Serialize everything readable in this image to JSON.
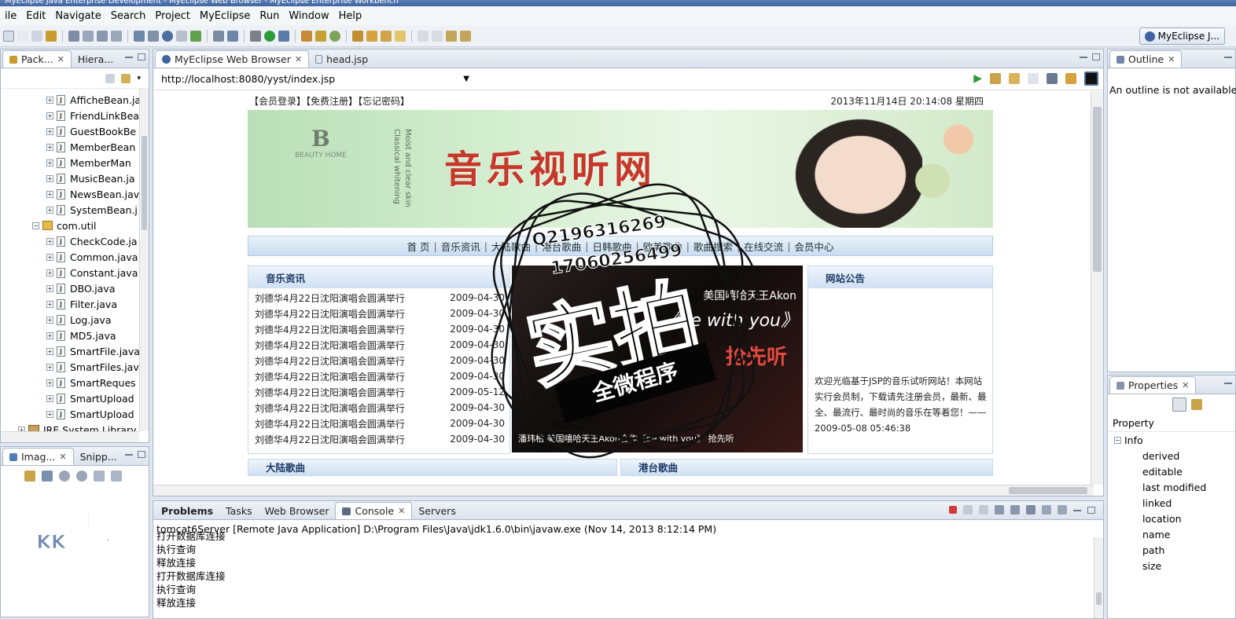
{
  "window": {
    "title": "MyEclipse Java Enterprise Development - MyEclipse Web Browser - MyEclipse Enterprise Workbench"
  },
  "menu": [
    "ile",
    "Edit",
    "Navigate",
    "Search",
    "Project",
    "MyEclipse",
    "Run",
    "Window",
    "Help"
  ],
  "perspective": {
    "label": "MyEclipse J..."
  },
  "explorer": {
    "tabs": [
      "Pack...",
      "Hiera..."
    ],
    "items": [
      "AfficheBean.ja",
      "FriendLinkBea",
      "GuestBookBe",
      "MemberBean",
      "MemberMan",
      "MusicBean.ja",
      "NewsBean.jav",
      "SystemBean.j"
    ],
    "package": "com.util",
    "util_items": [
      "CheckCode.ja",
      "Common.java",
      "Constant.java",
      "DBO.java",
      "Filter.java",
      "Log.java",
      "MD5.java",
      "SmartFile.java",
      "SmartFiles.jav",
      "SmartReques",
      "SmartUpload",
      "SmartUpload"
    ],
    "library": "JRE System Library"
  },
  "image_panel": {
    "tabs": [
      "Imag...",
      "Snipp..."
    ],
    "watermark": "录制工具 KK录像机"
  },
  "editor": {
    "tabs": [
      "MyEclipse Web Browser",
      "head.jsp"
    ],
    "url": "http://localhost:8080/yyst/index.jsp"
  },
  "site": {
    "links": "【会员登录】【免费注册】【忘记密码】",
    "datetime": "2013年11月14日 20:14:08  星期四",
    "banner_title": "音乐视听网",
    "banner_logo": "BEAUTY HOME",
    "banner_tagline": "Moist and clear skin Classical whitening",
    "nav": [
      "首 页",
      "音乐资讯",
      "大陆歌曲",
      "港台歌曲",
      "日韩歌曲",
      "欧美歌曲",
      "歌曲搜索",
      "在线交流",
      "会员中心"
    ],
    "news_title": "音乐资讯",
    "news": [
      {
        "title": "刘德华4月22日沈阳演唱会圆满举行",
        "date": "2009-04-30"
      },
      {
        "title": "刘德华4月22日沈阳演唱会圆满举行",
        "date": "2009-04-30"
      },
      {
        "title": "刘德华4月22日沈阳演唱会圆满举行",
        "date": "2009-04-30"
      },
      {
        "title": "刘德华4月22日沈阳演唱会圆满举行",
        "date": "2009-04-30"
      },
      {
        "title": "刘德华4月22日沈阳演唱会圆满举行",
        "date": "2009-04-30"
      },
      {
        "title": "刘德华4月22日沈阳演唱会圆满举行",
        "date": "2009-04-30"
      },
      {
        "title": "刘德华4月22日沈阳演唱会圆满举行",
        "date": "2009-05-12"
      },
      {
        "title": "刘德华4月22日沈阳演唱会圆满举行",
        "date": "2009-04-30"
      },
      {
        "title": "刘德华4月22日沈阳演唱会圆满举行",
        "date": "2009-04-30"
      },
      {
        "title": "刘德华4月22日沈阳演唱会圆满举行",
        "date": "2009-04-30"
      }
    ],
    "video": {
      "line1": "美国嘻哈天王Akon",
      "line2": "《be with you》",
      "red": "抢先听",
      "bottom": "潘玮柏 美国嘻哈天王Akon合作《be with you》 抢先听"
    },
    "notice_title": "网站公告",
    "notice_text": "欢迎光临基于JSP的音乐试听网站！本网站实行会员制，下载请先注册会员，最新、最全、最流行、最时尚的音乐在等着您！——2009-05-08 05:46:38",
    "sub_heads": [
      "大陆歌曲",
      "港台歌曲"
    ]
  },
  "watermark": {
    "qq1": "Q2196316269",
    "qq2": "17060256499",
    "big": "实拍",
    "ribbon": "全微程序"
  },
  "outline": {
    "tab": "Outline",
    "message": "An outline is not available."
  },
  "properties": {
    "tab": "Properties",
    "header": "Property",
    "group": "Info",
    "rows": [
      "derived",
      "editable",
      "last modified",
      "linked",
      "location",
      "name",
      "path",
      "size"
    ]
  },
  "console": {
    "tabs": [
      "Problems",
      "Tasks",
      "Web Browser",
      "Console",
      "Servers"
    ],
    "info": "tomcat6Server [Remote Java Application] D:\\Program Files\\Java\\jdk1.6.0\\bin\\javaw.exe (Nov 14, 2013 8:12:14 PM)",
    "lines": [
      "打开数据库连接",
      "执行查询",
      "释放连接",
      "打开数据库连接",
      "执行查询",
      "释放连接"
    ]
  },
  "colors": {
    "accent": "#3f64a0",
    "banner_red": "#c5382a"
  }
}
